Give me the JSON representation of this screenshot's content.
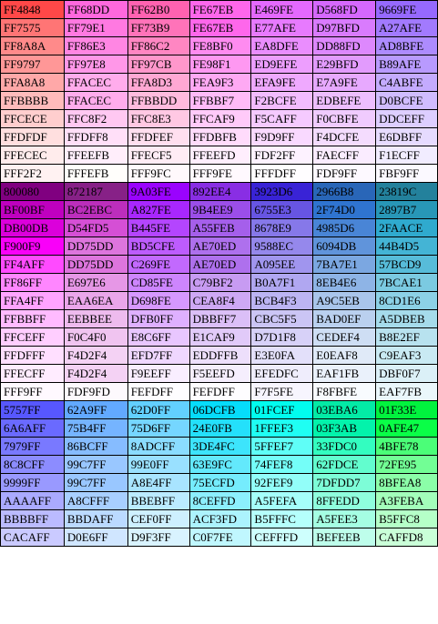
{
  "color_table": {
    "rows": [
      [
        "FF4848",
        "FF68DD",
        "FF62B0",
        "FE67EB",
        "E469FE",
        "D568FD",
        "9669FE"
      ],
      [
        "FF7575",
        "FF79E1",
        "FF73B9",
        "FE67EB",
        "E77AFE",
        "D97BFD",
        "A27AFE"
      ],
      [
        "FF8A8A",
        "FF86E3",
        "FF86C2",
        "FE8BF0",
        "EA8DFE",
        "DD88FD",
        "AD8BFE"
      ],
      [
        "FF9797",
        "FF97E8",
        "FF97CB",
        "FE98F1",
        "ED9EFE",
        "E29BFD",
        "B89AFE"
      ],
      [
        "FFA8A8",
        "FFACEC",
        "FFA8D3",
        "FEA9F3",
        "EFA9FE",
        "E7A9FE",
        "C4ABFE"
      ],
      [
        "FFBBBB",
        "FFACEC",
        "FFBBDD",
        "FFBBF7",
        "F2BCFE",
        "EDBEFE",
        "D0BCFE"
      ],
      [
        "FFCECE",
        "FFC8F2",
        "FFC8E3",
        "FFCAF9",
        "F5CAFF",
        "F0CBFE",
        "DDCEFF"
      ],
      [
        "FFDFDF",
        "FFDFF8",
        "FFDFEF",
        "FFDBFB",
        "F9D9FF",
        "F4DCFE",
        "E6DBFF"
      ],
      [
        "FFECEC",
        "FFEEFB",
        "FFECF5",
        "FFEEFD",
        "FDF2FF",
        "FAECFF",
        "F1ECFF"
      ],
      [
        "FFF2F2",
        "FFFEFB",
        "FFF9FC",
        "FFF9FE",
        "FFFDFF",
        "FDF9FF",
        "FBF9FF"
      ],
      [
        "800080",
        "872187",
        "9A03FE",
        "892EE4",
        "3923D6",
        "2966B8",
        "23819C"
      ],
      [
        "BF00BF",
        "BC2EBC",
        "A827FE",
        "9B4EE9",
        "6755E3",
        "2F74D0",
        "2897B7"
      ],
      [
        "DB00DB",
        "D54FD5",
        "B445FE",
        "A55FEB",
        "8678E9",
        "4985D6",
        "2FAACE"
      ],
      [
        "F900F9",
        "DD75DD",
        "BD5CFE",
        "AE70ED",
        "9588EC",
        "6094DB",
        "44B4D5"
      ],
      [
        "FF4AFF",
        "DD75DD",
        "C269FE",
        "AE70ED",
        "A095EE",
        "7BA7E1",
        "57BCD9"
      ],
      [
        "FF86FF",
        "E697E6",
        "CD85FE",
        "C79BF2",
        "B0A7F1",
        "8EB4E6",
        "7BCAE1"
      ],
      [
        "FFA4FF",
        "EAA6EA",
        "D698FE",
        "CEA8F4",
        "BCB4F3",
        "A9C5EB",
        "8CD1E6"
      ],
      [
        "FFBBFF",
        "EEBBEE",
        "DFB0FF",
        "DBBFF7",
        "CBC5F5",
        "BAD0EF",
        "A5DBEB"
      ],
      [
        "FFCEFF",
        "F0C4F0",
        "E8C6FF",
        "E1CAF9",
        "D7D1F8",
        "CEDEF4",
        "B8E2EF"
      ],
      [
        "FFDFFF",
        "F4D2F4",
        "EFD7FF",
        "EDDFFB",
        "E3E0FA",
        "E0EAF8",
        "C9EAF3"
      ],
      [
        "FFECFF",
        "F4D2F4",
        "F9EEFF",
        "F5EEFD",
        "EFEDFC",
        "EAF1FB",
        "DBF0F7"
      ],
      [
        "FFF9FF",
        "FDF9FD",
        "FEFDFF",
        "FEFDFF",
        "F7F5FE",
        "F8FBFE",
        "EAF7FB"
      ],
      [
        "5757FF",
        "62A9FF",
        "62D0FF",
        "06DCFB",
        "01FCEF",
        "03EBA6",
        "01F33E"
      ],
      [
        "6A6AFF",
        "75B4FF",
        "75D6FF",
        "24E0FB",
        "1FFEF3",
        "03F3AB",
        "0AFE47"
      ],
      [
        "7979FF",
        "86BCFF",
        "8ADCFF",
        "3DE4FC",
        "5FFEF7",
        "33FDC0",
        "4BFE78"
      ],
      [
        "8C8CFF",
        "99C7FF",
        "99E0FF",
        "63E9FC",
        "74FEF8",
        "62FDCE",
        "72FE95"
      ],
      [
        "9999FF",
        "99C7FF",
        "A8E4FF",
        "75ECFD",
        "92FEF9",
        "7DFDD7",
        "8BFEA8"
      ],
      [
        "AAAAFF",
        "A8CFFF",
        "BBEBFF",
        "8CEFFD",
        "A5FEFA",
        "8FFEDD",
        "A3FEBA"
      ],
      [
        "BBBBFF",
        "BBDAFF",
        "CEF0FF",
        "ACF3FD",
        "B5FFFC",
        "A5FEE3",
        "B5FFC8"
      ],
      [
        "CACAFF",
        "D0E6FF",
        "D9F3FF",
        "C0F7FE",
        "CEFFFD",
        "BEFEEB",
        "CAFFD8"
      ]
    ],
    "fills": [
      [
        "#FF4848",
        "#FF68DD",
        "#FF62B0",
        "#FE67EB",
        "#E469FE",
        "#D568FD",
        "#9669FE"
      ],
      [
        "#FF7575",
        "#FF79E1",
        "#FF73B9",
        "#FE67EB",
        "#E77AFE",
        "#D97BFD",
        "#A27AFE"
      ],
      [
        "#FF8A8A",
        "#FF86E3",
        "#FF86C2",
        "#FE8BF0",
        "#EA8DFE",
        "#DD88FD",
        "#AD8BFE"
      ],
      [
        "#FF9797",
        "#FF97E8",
        "#FF97CB",
        "#FE98F1",
        "#ED9EFE",
        "#E29BFD",
        "#B89AFE"
      ],
      [
        "#FFA8A8",
        "#FFACEC",
        "#FFA8D3",
        "#FEA9F3",
        "#EFA9FE",
        "#E7A9FE",
        "#C4ABFE"
      ],
      [
        "#FFBBBB",
        "#FFACEC",
        "#FFBBDD",
        "#FFBBF7",
        "#F2BCFE",
        "#EDBEFE",
        "#D0BCFE"
      ],
      [
        "#FFCECE",
        "#FFC8F2",
        "#FFC8E3",
        "#FFCAF9",
        "#F5CAFF",
        "#F0CBFE",
        "#DDCEFF"
      ],
      [
        "#FFDFDF",
        "#FFDFF8",
        "#FFDFEF",
        "#FFDBFB",
        "#F9D9FF",
        "#F4DCFE",
        "#E6DBFF"
      ],
      [
        "#FFECEC",
        "#FFEEFB",
        "#FFECF5",
        "#FFEEFD",
        "#FDF2FF",
        "#FAECFF",
        "#F1ECFF"
      ],
      [
        "#FFF2F2",
        "#FFFEFB",
        "#FFF9FC",
        "#FFF9FE",
        "#FFFDFF",
        "#FDF9FF",
        "#FBF9FF"
      ],
      [
        "#800080",
        "#872187",
        "#9A03FE",
        "#892EE4",
        "#3923D6",
        "#2966B8",
        "#23819C"
      ],
      [
        "#BF00BF",
        "#BC2EBC",
        "#A827FE",
        "#9B4EE9",
        "#6755E3",
        "#2F74D0",
        "#2897B7"
      ],
      [
        "#DB00DB",
        "#D54FD5",
        "#B445FE",
        "#A55FEB",
        "#8678E9",
        "#4985D6",
        "#2FAACE"
      ],
      [
        "#F900F9",
        "#DD75DD",
        "#BD5CFE",
        "#AE70ED",
        "#9588EC",
        "#6094DB",
        "#44B4D5"
      ],
      [
        "#FF4AFF",
        "#DD75DD",
        "#C269FE",
        "#AE70ED",
        "#A095EE",
        "#7BA7E1",
        "#57BCD9"
      ],
      [
        "#FF86FF",
        "#E697E6",
        "#CD85FE",
        "#C79BF2",
        "#B0A7F1",
        "#8EB4E6",
        "#7BCAE1"
      ],
      [
        "#FFA4FF",
        "#EAA6EA",
        "#D698FE",
        "#CEA8F4",
        "#BCB4F3",
        "#A9C5EB",
        "#8CD1E6"
      ],
      [
        "#FFBBFF",
        "#EEBBEE",
        "#DFB0FF",
        "#DBBFF7",
        "#CBC5F5",
        "#BAD0EF",
        "#A5DBEB"
      ],
      [
        "#FFCEFF",
        "#F0C4F0",
        "#E8C6FF",
        "#E1CAF9",
        "#D7D1F8",
        "#CEDEF4",
        "#B8E2EF"
      ],
      [
        "#FFDFFF",
        "#F4D2F4",
        "#EFD7FF",
        "#EDDFFB",
        "#E3E0FA",
        "#E0EAF8",
        "#C9EAF3"
      ],
      [
        "#FFECFF",
        "#F4D2F4",
        "#F9EEFF",
        "#F5EEFD",
        "#EFEDFC",
        "#EAF1FB",
        "#DBF0F7"
      ],
      [
        "#FFF9FF",
        "#FDF9FD",
        "#FEFDFF",
        "#FEFDFF",
        "#F7F5FE",
        "#F8FBFE",
        "#EAF7FB"
      ],
      [
        "#5757FF",
        "#62A9FF",
        "#62D0FF",
        "#06DCFB",
        "#01FCEF",
        "#03EBA6",
        "#01F33E"
      ],
      [
        "#6A6AFF",
        "#75B4FF",
        "#75D6FF",
        "#24E0FB",
        "#1FFEF3",
        "#03F3AB",
        "#0AFE47"
      ],
      [
        "#7979FF",
        "#86BCFF",
        "#8ADCFF",
        "#3DE4FC",
        "#5FFEF7",
        "#33FDC0",
        "#4BFE78"
      ],
      [
        "#8C8CFF",
        "#99C7FF",
        "#99E0FF",
        "#63E9FC",
        "#74FEF8",
        "#62FDCE",
        "#72FE95"
      ],
      [
        "#9999FF",
        "#99C7FF",
        "#A8E4FF",
        "#75ECFD",
        "#92FEF9",
        "#7DFDD7",
        "#8BFEA8"
      ],
      [
        "#AAAAFF",
        "#A8CFFF",
        "#BBEBFF",
        "#8CEFFD",
        "#A5FEFA",
        "#8FFEDD",
        "#A3FEBA"
      ],
      [
        "#BBBBFF",
        "#BBDAFF",
        "#CEF0FF",
        "#ACF3FD",
        "#B5FFFC",
        "#A5FEE3",
        "#B5FFC8"
      ],
      [
        "#CACAFF",
        "#D0E6FF",
        "#D9F3FF",
        "#C0F7FE",
        "#CEFFFD",
        "#BEFEEB",
        "#CAFFD8"
      ]
    ],
    "text_color": "#000000",
    "border_color": "#000000"
  }
}
